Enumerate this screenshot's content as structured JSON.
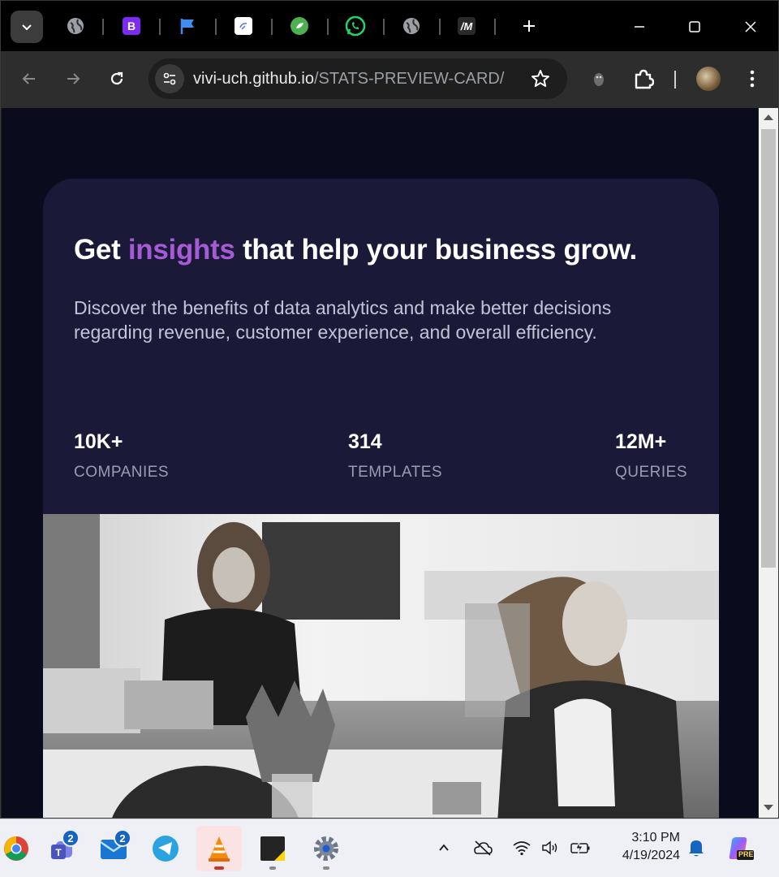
{
  "browser": {
    "tabs": [
      {
        "icon": "globe-icon"
      },
      {
        "icon": "bootstrap-icon",
        "glyph": "B"
      },
      {
        "icon": "flag-icon"
      },
      {
        "icon": "figma-like-icon"
      },
      {
        "icon": "green-app-icon"
      },
      {
        "icon": "whatsapp-icon"
      },
      {
        "icon": "globe-icon"
      },
      {
        "icon": "mm-icon",
        "glyph": "/M"
      }
    ],
    "url_host": "vivi-uch.github.io",
    "url_path": "/STATS-PREVIEW-CARD/"
  },
  "card": {
    "headline_pre": "Get ",
    "headline_accent": "insights",
    "headline_post": " that help your business grow.",
    "description": "Discover the benefits of data analytics and make better decisions regarding revenue, customer experience, and overall efficiency.",
    "stats": [
      {
        "value": "10K+",
        "label": "COMPANIES"
      },
      {
        "value": "314",
        "label": "TEMPLATES"
      },
      {
        "value": "12M+",
        "label": "QUERIES"
      }
    ],
    "accent_color": "#a65bd6",
    "card_color": "#1b1938",
    "page_color": "#0a0c1d"
  },
  "taskbar": {
    "apps": [
      {
        "name": "chrome"
      },
      {
        "name": "teams",
        "badge": "2"
      },
      {
        "name": "mail",
        "badge": "2"
      },
      {
        "name": "telegram"
      },
      {
        "name": "vlc"
      },
      {
        "name": "sticky-notes"
      },
      {
        "name": "settings"
      }
    ],
    "time": "3:10 PM",
    "date": "4/19/2024",
    "copilot_label": "PRE"
  }
}
